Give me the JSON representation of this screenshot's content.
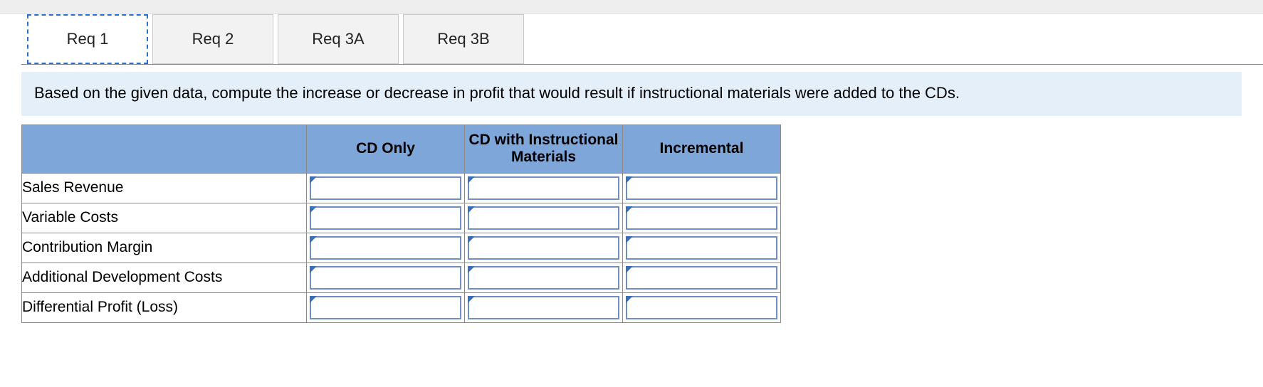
{
  "tabs": [
    {
      "label": "Req 1",
      "active": true
    },
    {
      "label": "Req 2",
      "active": false
    },
    {
      "label": "Req 3A",
      "active": false
    },
    {
      "label": "Req 3B",
      "active": false
    }
  ],
  "instruction": "Based on the given data, compute the increase or decrease in profit that would result if instructional materials were added to the CDs.",
  "table": {
    "columns": [
      "CD Only",
      "CD with Instructional Materials",
      "Incremental"
    ],
    "rows": [
      {
        "label": "Sales Revenue",
        "values": [
          "",
          "",
          ""
        ]
      },
      {
        "label": "Variable Costs",
        "values": [
          "",
          "",
          ""
        ]
      },
      {
        "label": "Contribution Margin",
        "values": [
          "",
          "",
          ""
        ]
      },
      {
        "label": "Additional Development Costs",
        "values": [
          "",
          "",
          ""
        ]
      },
      {
        "label": "Differential Profit (Loss)",
        "values": [
          "",
          "",
          ""
        ]
      }
    ]
  }
}
